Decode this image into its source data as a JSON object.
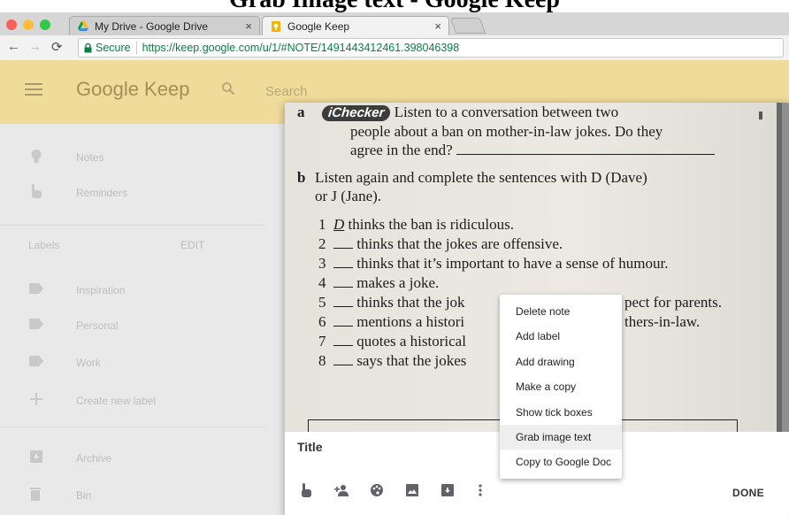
{
  "slide": {
    "title": "Grab Image text - Google Keep"
  },
  "browser": {
    "tabs": [
      {
        "label": "My Drive - Google Drive",
        "icon": "google-drive-icon",
        "active": false
      },
      {
        "label": "Google Keep",
        "icon": "google-keep-icon",
        "active": true
      }
    ],
    "tab_close_glyph": "×",
    "secure_label": "Secure",
    "url": "https://keep.google.com/u/1/#NOTE/1491443412461.398046398"
  },
  "keep": {
    "brand": "Google Keep",
    "search_placeholder": "Search",
    "header_color": "#efdb9a",
    "sidebar": {
      "items": [
        {
          "label": "Notes",
          "icon": "lightbulb-icon"
        },
        {
          "label": "Reminders",
          "icon": "reminder-hand-icon"
        }
      ],
      "labels_heading": "Labels",
      "edit_label": "EDIT",
      "label_items": [
        {
          "label": "Inspiration",
          "icon": "label-icon"
        },
        {
          "label": "Personal",
          "icon": "label-icon"
        },
        {
          "label": "Work",
          "icon": "label-icon"
        },
        {
          "label": "Create new label",
          "icon": "plus-icon"
        }
      ],
      "bottom_items": [
        {
          "label": "Archive",
          "icon": "archive-icon"
        },
        {
          "label": "Bin",
          "icon": "trash-icon"
        }
      ]
    },
    "note": {
      "title_placeholder": "Title",
      "done_label": "DONE",
      "footer_icons": [
        "remind-me-icon",
        "collaborator-icon",
        "palette-icon",
        "image-icon",
        "archive-icon",
        "more-icon"
      ],
      "image_text": {
        "a_letter": "a",
        "ichecker": "iChecker",
        "a_line1": "Listen to a conversation between two",
        "a_line2": "people about a ban on mother-in-law jokes. Do they",
        "a_line3": "agree in the end?",
        "b_letter": "b",
        "b_line1": "Listen again and complete the sentences with D (Dave)",
        "b_line2": "or J (Jane).",
        "items": [
          {
            "num": "1",
            "prefix": "D",
            "text": "thinks the ban is ridiculous."
          },
          {
            "num": "2",
            "prefix": "",
            "text": "thinks that the jokes are offensive."
          },
          {
            "num": "3",
            "prefix": "",
            "text": "thinks that it’s important to have a sense of humour."
          },
          {
            "num": "4",
            "prefix": "",
            "text": "makes a joke."
          },
          {
            "num": "5",
            "prefix": "",
            "text": "thinks that the jok"
          },
          {
            "num": "6",
            "prefix": "",
            "text": "mentions a histori"
          },
          {
            "num": "7",
            "prefix": "",
            "text": "quotes a historical"
          },
          {
            "num": "8",
            "prefix": "",
            "text": "says that the jokes"
          }
        ],
        "item5_tail": "pect for parents.",
        "item6_tail": "thers-in-law."
      }
    },
    "context_menu": {
      "items": [
        "Delete note",
        "Add label",
        "Add drawing",
        "Make a copy",
        "Show tick boxes",
        "Grab image text",
        "Copy to Google Doc"
      ],
      "highlighted": "Grab image text"
    }
  }
}
